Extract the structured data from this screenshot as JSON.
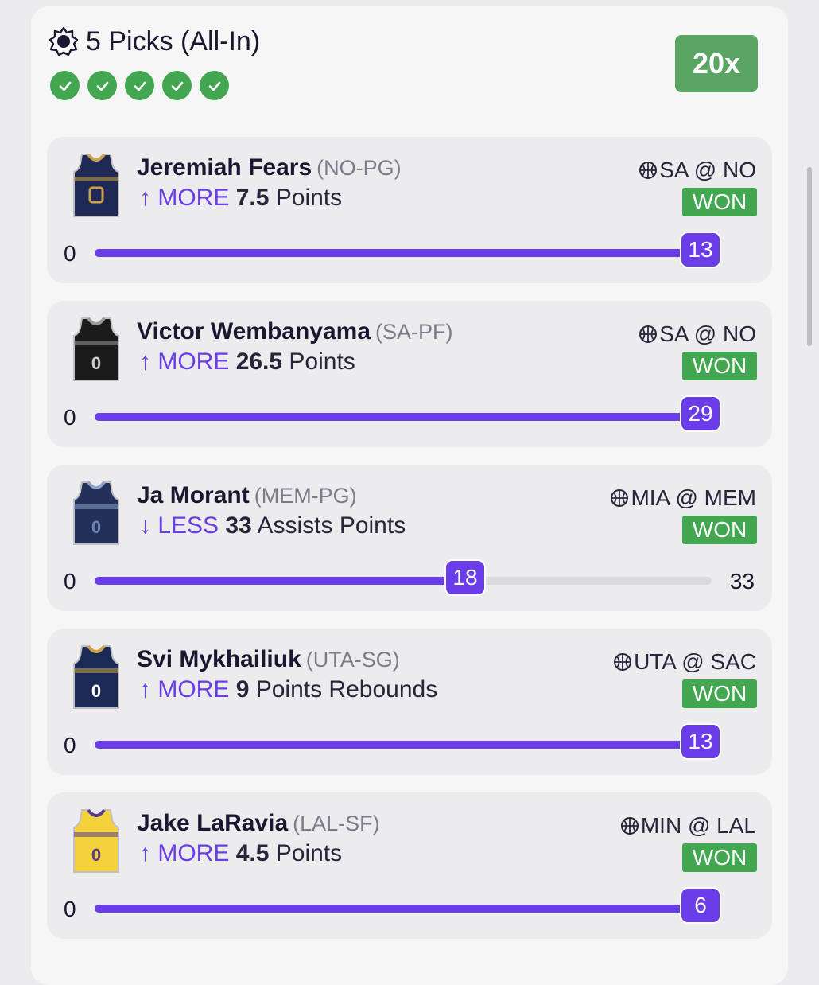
{
  "header": {
    "title": "5 Picks (All-In)",
    "multiplier": "20x",
    "checks": 5,
    "icon": "sun-icon"
  },
  "colors": {
    "accent": "#6a3de8",
    "won": "#43a751",
    "multiplier": "#5aa564"
  },
  "picks": [
    {
      "name": "Jeremiah Fears",
      "position": "(NO-PG)",
      "direction": "MORE",
      "arrow": "↑",
      "target": "7.5",
      "stat": "Points",
      "game": "SA @ NO",
      "result": "WON",
      "min": "0",
      "actual": "13",
      "max": "",
      "progress": 1.0,
      "jersey": {
        "body": "#1e2a55",
        "trim": "#c9a24a",
        "number": "",
        "accent": "#b8324a"
      }
    },
    {
      "name": "Victor Wembanyama",
      "position": "(SA-PF)",
      "direction": "MORE",
      "arrow": "↑",
      "target": "26.5",
      "stat": "Points",
      "game": "SA @ NO",
      "result": "WON",
      "min": "0",
      "actual": "29",
      "max": "",
      "progress": 1.0,
      "jersey": {
        "body": "#1b1b1b",
        "trim": "#9a9a9a",
        "number": "0",
        "accent": "#d0d0d0"
      }
    },
    {
      "name": "Ja Morant",
      "position": "(MEM-PG)",
      "direction": "LESS",
      "arrow": "↓",
      "target": "33",
      "stat": "Assists Points",
      "game": "MIA @ MEM",
      "result": "WON",
      "min": "0",
      "actual": "18",
      "max": "33",
      "progress": 0.6,
      "jersey": {
        "body": "#22305a",
        "trim": "#8aa3c8",
        "number": "0",
        "accent": "#6d86ad"
      }
    },
    {
      "name": "Svi Mykhailiuk",
      "position": "(UTA-SG)",
      "direction": "MORE",
      "arrow": "↑",
      "target": "9",
      "stat": "Points Rebounds",
      "game": "UTA @ SAC",
      "result": "WON",
      "min": "0",
      "actual": "13",
      "max": "",
      "progress": 1.0,
      "jersey": {
        "body": "#1b2a55",
        "trim": "#c9a24a",
        "number": "0",
        "accent": "#ffffff"
      }
    },
    {
      "name": "Jake LaRavia",
      "position": "(LAL-SF)",
      "direction": "MORE",
      "arrow": "↑",
      "target": "4.5",
      "stat": "Points",
      "game": "MIN @ LAL",
      "result": "WON",
      "min": "0",
      "actual": "6",
      "max": "",
      "progress": 1.0,
      "jersey": {
        "body": "#f4d23c",
        "trim": "#5b3b8c",
        "number": "0",
        "accent": "#5b3b8c"
      }
    }
  ]
}
